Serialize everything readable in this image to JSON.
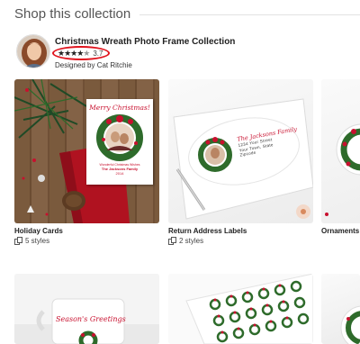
{
  "section": {
    "title": "Shop this collection"
  },
  "collection": {
    "title": "Christmas Wreath Photo Frame Collection",
    "stars": "★★★★",
    "half_star": "★",
    "empty_star": "☆",
    "rating": "3.7",
    "designer": "Designed by Cat Ritchie"
  },
  "products": [
    {
      "label": "Holiday Cards",
      "styles": "5 styles",
      "card_text": {
        "greeting": "Merry Christmas!",
        "line": "Wonderful Christmas Wishes",
        "name": "The Jacksons Family",
        "year": "2014"
      }
    },
    {
      "label": "Return Address Labels",
      "styles": "2 styles",
      "label_text": {
        "family": "The Jacksons Family",
        "line1": "1234 Your Street",
        "line2": "Your Town, State",
        "line3": "Zipcode"
      }
    },
    {
      "label": "Ornaments"
    }
  ],
  "mug_text": "Season's Greetings",
  "colors": {
    "accent_red": "#c8102e",
    "rating_oval": "#e0141e",
    "wreath_green": "#2e6b2b"
  }
}
